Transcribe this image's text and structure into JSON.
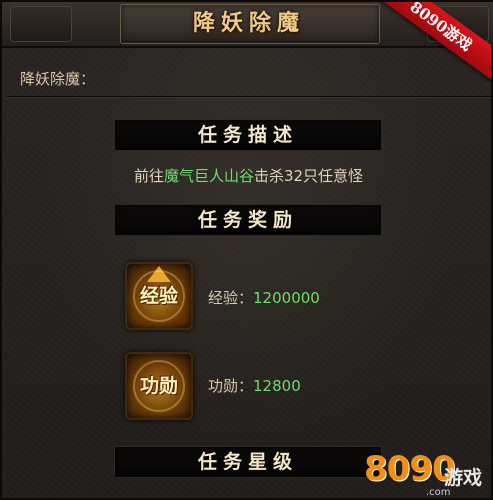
{
  "window": {
    "title": "降妖除魔",
    "ribbon": "8090游戏"
  },
  "task": {
    "name_label": "降妖除魔：",
    "description_header": "任务描述",
    "description": {
      "prefix": "前往",
      "location": "魔气巨人山谷",
      "suffix": "击杀32只任意怪"
    },
    "rewards_header": "任务奖励",
    "rewards": [
      {
        "icon": "experience-icon",
        "icon_text": "经验",
        "label": "经验：",
        "value": "1200000"
      },
      {
        "icon": "merit-icon",
        "icon_text": "功勋",
        "label": "功勋：",
        "value": "12800"
      }
    ],
    "rating_header": "任务星级"
  },
  "watermark": {
    "number": "8090",
    "name": "游戏",
    "url": ".com"
  },
  "colors": {
    "title_gold": "#f0c984",
    "highlight_green": "#6fdc6f",
    "ribbon_red": "#d8131b",
    "logo_orange": "#f38d14"
  }
}
